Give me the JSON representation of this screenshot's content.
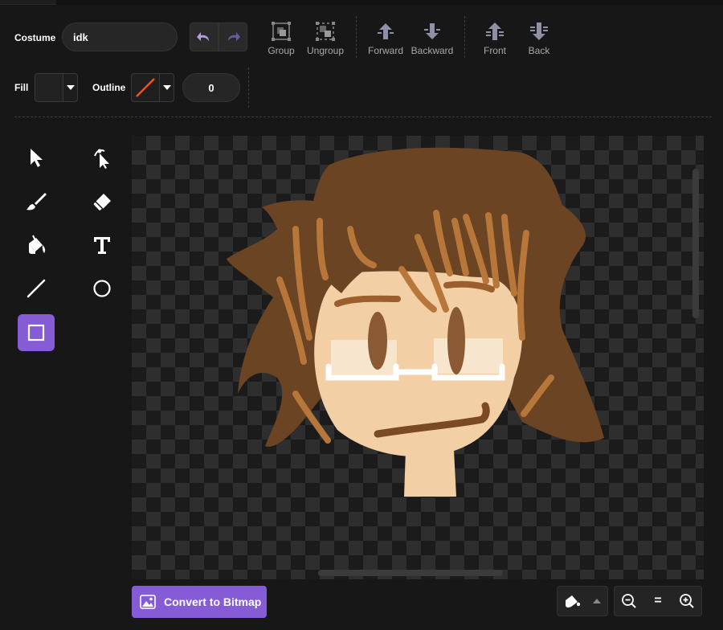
{
  "costume": {
    "label": "Costume",
    "name_value": "idk"
  },
  "toolbar": {
    "group_label": "Group",
    "ungroup_label": "Ungroup",
    "forward_label": "Forward",
    "backward_label": "Backward",
    "front_label": "Front",
    "back_label": "Back"
  },
  "style": {
    "fill_label": "Fill",
    "fill_color": "#222222",
    "outline_label": "Outline",
    "outline_color": "#f4511e",
    "outline_width": "0"
  },
  "tools": [
    {
      "name": "select-tool-icon",
      "active": false
    },
    {
      "name": "reshape-tool-icon",
      "active": false
    },
    {
      "name": "brush-tool-icon",
      "active": false
    },
    {
      "name": "eraser-tool-icon",
      "active": false
    },
    {
      "name": "fill-tool-icon",
      "active": false
    },
    {
      "name": "text-tool-icon",
      "active": false
    },
    {
      "name": "line-tool-icon",
      "active": false
    },
    {
      "name": "circle-tool-icon",
      "active": false
    },
    {
      "name": "rectangle-tool-icon",
      "active": true
    }
  ],
  "bottom": {
    "convert_label": "Convert to Bitmap",
    "zoom_reset_label": "="
  },
  "colors": {
    "accent": "#855cd6",
    "hair": "#6b4423",
    "hair_highlight": "#b8773a",
    "skin": "#f3cfa6",
    "glasses": "#ffffff"
  }
}
